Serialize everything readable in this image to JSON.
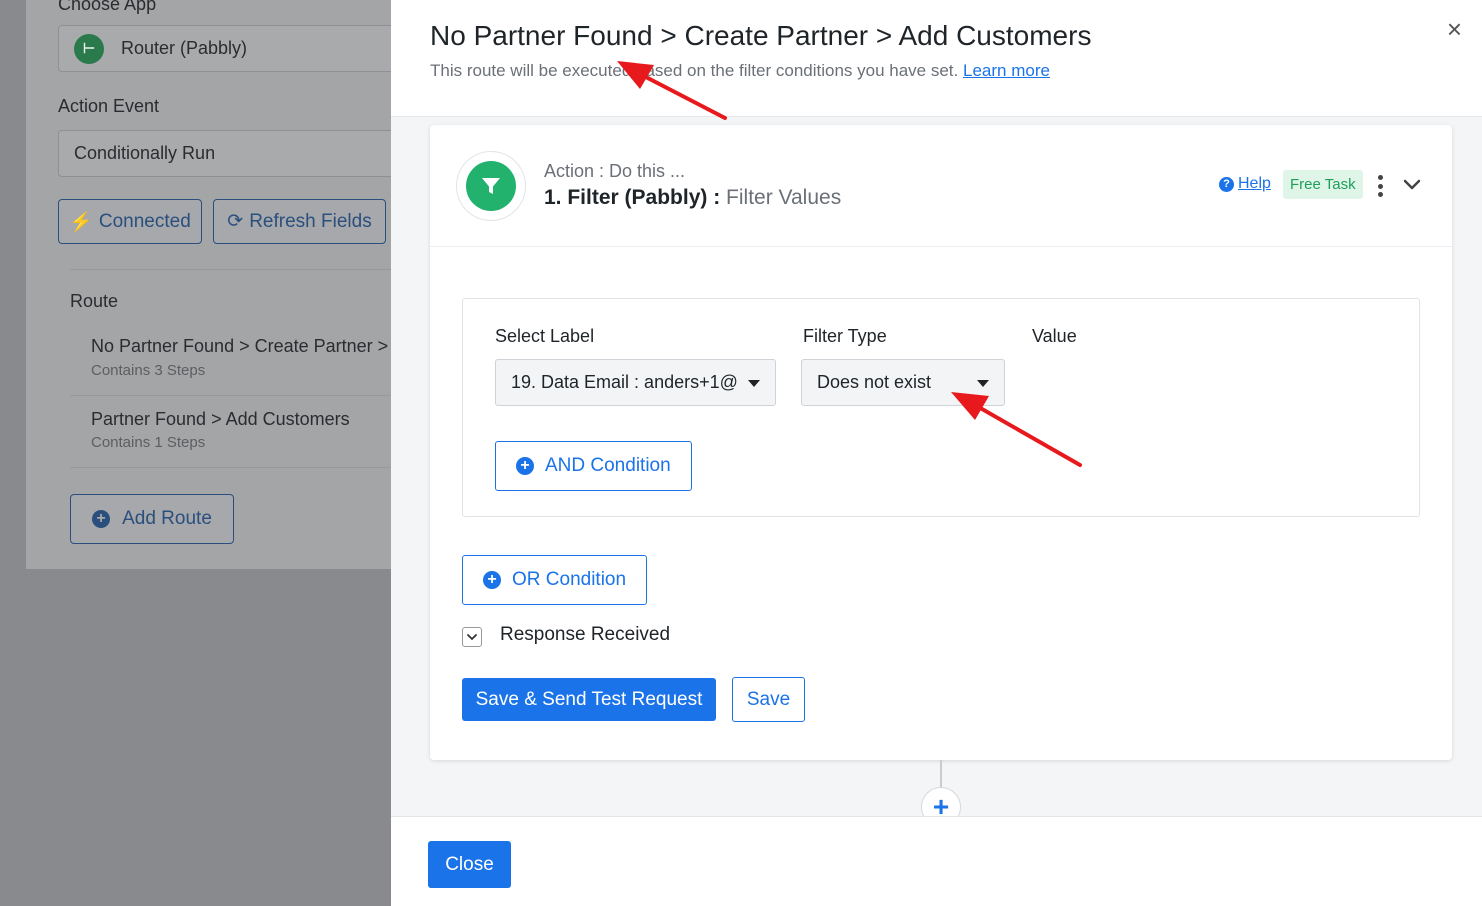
{
  "background": {
    "choose_app_label": "Choose App",
    "app_name": "Router (Pabbly)",
    "action_event_label": "Action Event",
    "action_event_value": "Conditionally Run",
    "connected_button": "Connected",
    "refresh_button": "Refresh Fields",
    "route_heading": "Route",
    "routes": [
      {
        "title": "No Partner Found > Create Partner > Add Customers",
        "steps": "Contains 3 Steps"
      },
      {
        "title": "Partner Found > Add Customers",
        "steps": "Contains 1 Steps"
      }
    ],
    "add_route_button": "Add Route"
  },
  "modal": {
    "title": "No Partner Found > Create Partner > Add Customers",
    "subtitle": "This route will be executed based on the filter conditions you have set.",
    "learn_more": "Learn more",
    "close_x": "×",
    "step": {
      "action_label": "Action : Do this ...",
      "name": "1. Filter (Pabbly) :",
      "event": "Filter Values",
      "help": "Help",
      "badge": "Free Task"
    },
    "condition": {
      "select_label_heading": "Select Label",
      "filter_type_heading": "Filter Type",
      "value_heading": "Value",
      "select_label_value": "19. Data Email : anders+1@",
      "filter_type_value": "Does not exist",
      "and_button": "AND Condition"
    },
    "or_button": "OR Condition",
    "response_label": "Response Received",
    "save_send_button": "Save & Send Test Request",
    "save_button": "Save",
    "footer_close": "Close"
  },
  "colors": {
    "accent": "#1a73e8",
    "filter_green": "#23b26d",
    "badge_bg": "#dff5e8",
    "annotation_arrow": "#e8191c"
  }
}
